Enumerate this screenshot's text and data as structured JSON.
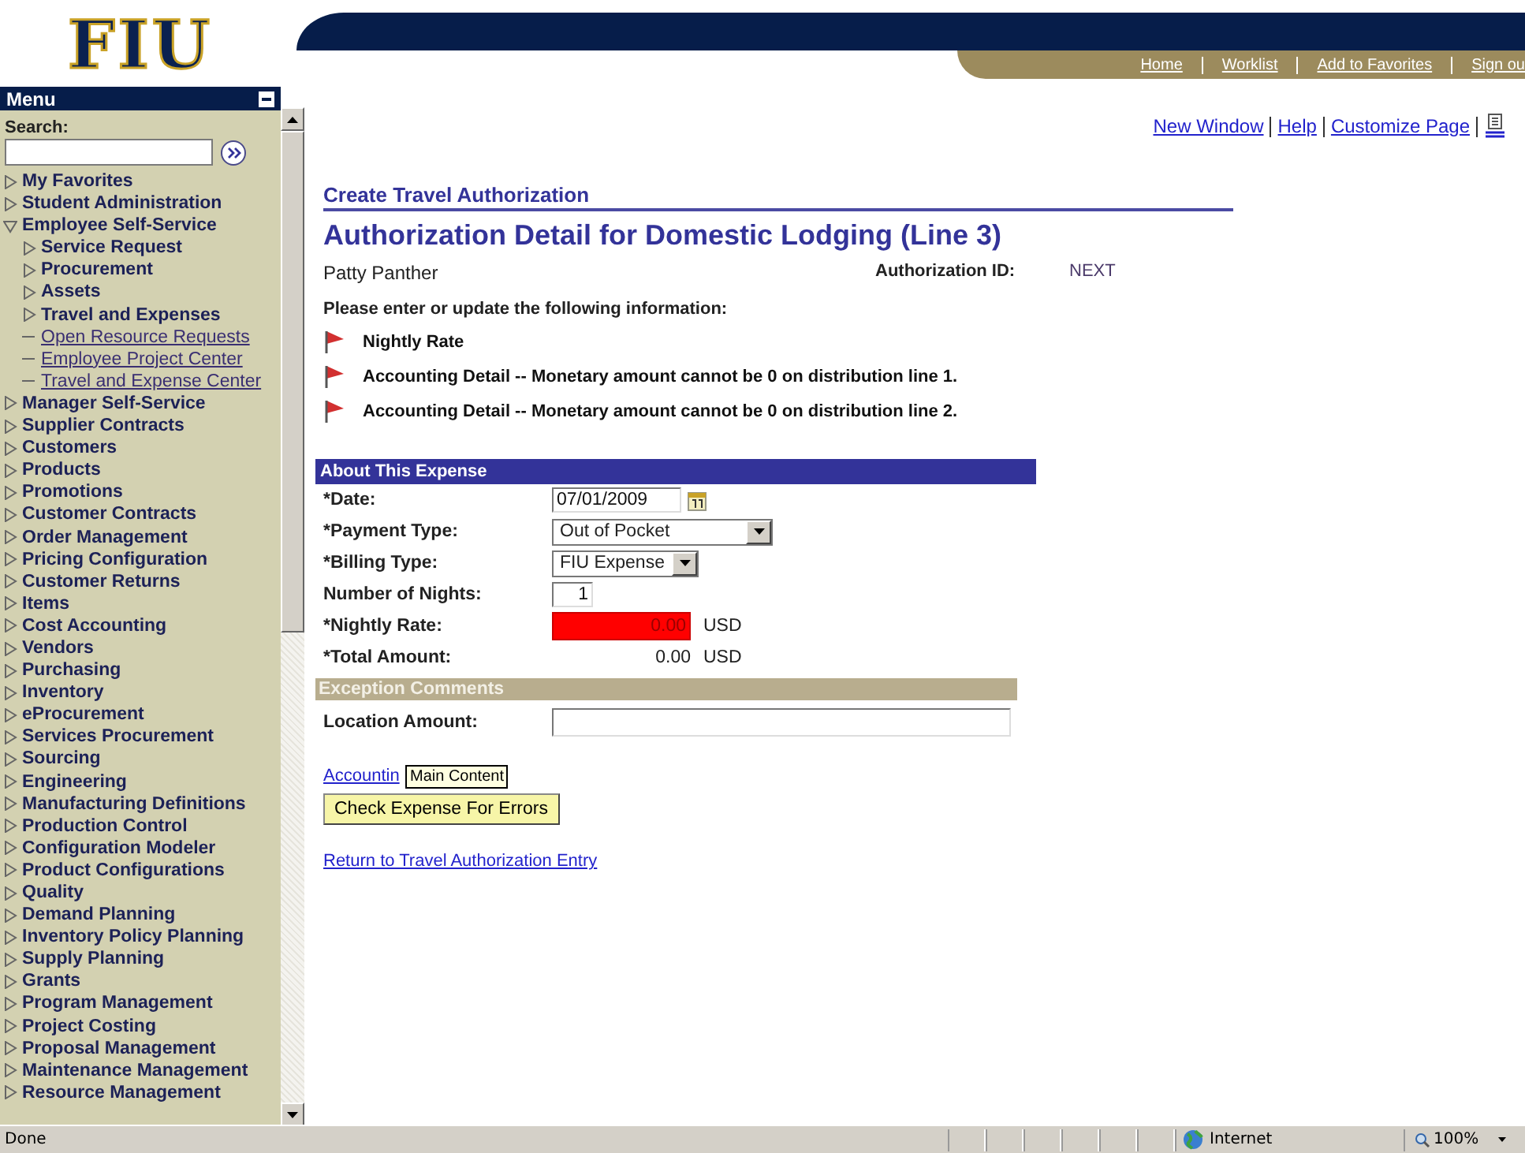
{
  "header": {
    "logo": "FIU",
    "nav_links": [
      "Home",
      "Worklist",
      "Add to Favorites",
      "Sign ou"
    ]
  },
  "menu": {
    "title": "Menu",
    "search_label": "Search:",
    "items": [
      {
        "label": "My Favorites",
        "kind": "folder",
        "expanded": false
      },
      {
        "label": "Student Administration",
        "kind": "folder",
        "expanded": false
      },
      {
        "label": "Employee Self-Service",
        "kind": "folder",
        "expanded": true,
        "children": [
          {
            "label": "Service Request",
            "kind": "folder",
            "expanded": false
          },
          {
            "label": "Procurement",
            "kind": "folder",
            "expanded": false
          },
          {
            "label": "Assets",
            "kind": "folder",
            "expanded": false
          },
          {
            "label": "Travel and Expenses",
            "kind": "folder",
            "expanded": false
          },
          {
            "label": "Open Resource Requests",
            "kind": "link"
          },
          {
            "label": "Employee Project Center",
            "kind": "link"
          },
          {
            "label": "Travel and Expense Center",
            "kind": "link"
          }
        ]
      },
      {
        "label": "Manager Self-Service",
        "kind": "folder",
        "expanded": false
      },
      {
        "label": "Supplier Contracts",
        "kind": "folder",
        "expanded": false
      },
      {
        "label": "Customers",
        "kind": "folder",
        "expanded": false
      },
      {
        "label": "Products",
        "kind": "folder",
        "expanded": false
      },
      {
        "label": "Promotions",
        "kind": "folder",
        "expanded": false
      },
      {
        "label": "Customer Contracts",
        "kind": "folder",
        "expanded": false
      },
      {
        "label": "Order Management",
        "kind": "folder",
        "expanded": false
      },
      {
        "label": "Pricing Configuration",
        "kind": "folder",
        "expanded": false
      },
      {
        "label": "Customer Returns",
        "kind": "folder",
        "expanded": false
      },
      {
        "label": "Items",
        "kind": "folder",
        "expanded": false
      },
      {
        "label": "Cost Accounting",
        "kind": "folder",
        "expanded": false
      },
      {
        "label": "Vendors",
        "kind": "folder",
        "expanded": false
      },
      {
        "label": "Purchasing",
        "kind": "folder",
        "expanded": false
      },
      {
        "label": "Inventory",
        "kind": "folder",
        "expanded": false
      },
      {
        "label": "eProcurement",
        "kind": "folder",
        "expanded": false
      },
      {
        "label": "Services Procurement",
        "kind": "folder",
        "expanded": false
      },
      {
        "label": "Sourcing",
        "kind": "folder",
        "expanded": false
      },
      {
        "label": "Engineering",
        "kind": "folder",
        "expanded": false
      },
      {
        "label": "Manufacturing Definitions",
        "kind": "folder",
        "expanded": false
      },
      {
        "label": "Production Control",
        "kind": "folder",
        "expanded": false
      },
      {
        "label": "Configuration Modeler",
        "kind": "folder",
        "expanded": false
      },
      {
        "label": "Product Configurations",
        "kind": "folder",
        "expanded": false
      },
      {
        "label": "Quality",
        "kind": "folder",
        "expanded": false
      },
      {
        "label": "Demand Planning",
        "kind": "folder",
        "expanded": false
      },
      {
        "label": "Inventory Policy Planning",
        "kind": "folder",
        "expanded": false
      },
      {
        "label": "Supply Planning",
        "kind": "folder",
        "expanded": false
      },
      {
        "label": "Grants",
        "kind": "folder",
        "expanded": false
      },
      {
        "label": "Program Management",
        "kind": "folder",
        "expanded": false
      },
      {
        "label": "Project Costing",
        "kind": "folder",
        "expanded": false
      },
      {
        "label": "Proposal Management",
        "kind": "folder",
        "expanded": false
      },
      {
        "label": "Maintenance Management",
        "kind": "folder",
        "expanded": false
      },
      {
        "label": "Resource Management",
        "kind": "folder",
        "expanded": false
      }
    ]
  },
  "page_links": [
    "New Window",
    "Help",
    "Customize Page"
  ],
  "breadcrumb": "Create Travel Authorization",
  "title": "Authorization Detail for Domestic Lodging (Line 3)",
  "employee": "Patty Panther",
  "authorization_id": {
    "label": "Authorization ID:",
    "value": "NEXT"
  },
  "instructions": "Please enter or update the following information:",
  "errors": [
    "Nightly Rate",
    "Accounting Detail -- Monetary amount cannot be 0 on distribution line 1.",
    "Accounting Detail -- Monetary amount cannot be 0 on distribution line 2."
  ],
  "about_section": {
    "title": "About This Expense",
    "fields": [
      {
        "label": "*Date:",
        "kind": "date",
        "value": "07/01/2009"
      },
      {
        "label": "*Payment Type:",
        "kind": "select",
        "value": "Out of Pocket"
      },
      {
        "label": "*Billing Type:",
        "kind": "select",
        "value": "FIU Expense"
      },
      {
        "label": "Number of Nights:",
        "kind": "number",
        "value": "1"
      },
      {
        "label": "*Nightly Rate:",
        "kind": "amount",
        "value": "0.00",
        "error": true,
        "unit": "USD"
      },
      {
        "label": "*Total Amount:",
        "kind": "display",
        "value": "0.00",
        "unit": "USD"
      }
    ]
  },
  "exception_section": {
    "title": "Exception Comments",
    "fields": [
      {
        "label": "Location Amount:",
        "kind": "text"
      }
    ]
  },
  "accounting_link": "Accountin",
  "tooltip": "Main Content",
  "check_button": "Check Expense For Errors",
  "return_link": "Return to Travel Authorization Entry",
  "status_bar": {
    "text": "Done",
    "zone": "Internet",
    "zoom": "100%"
  }
}
